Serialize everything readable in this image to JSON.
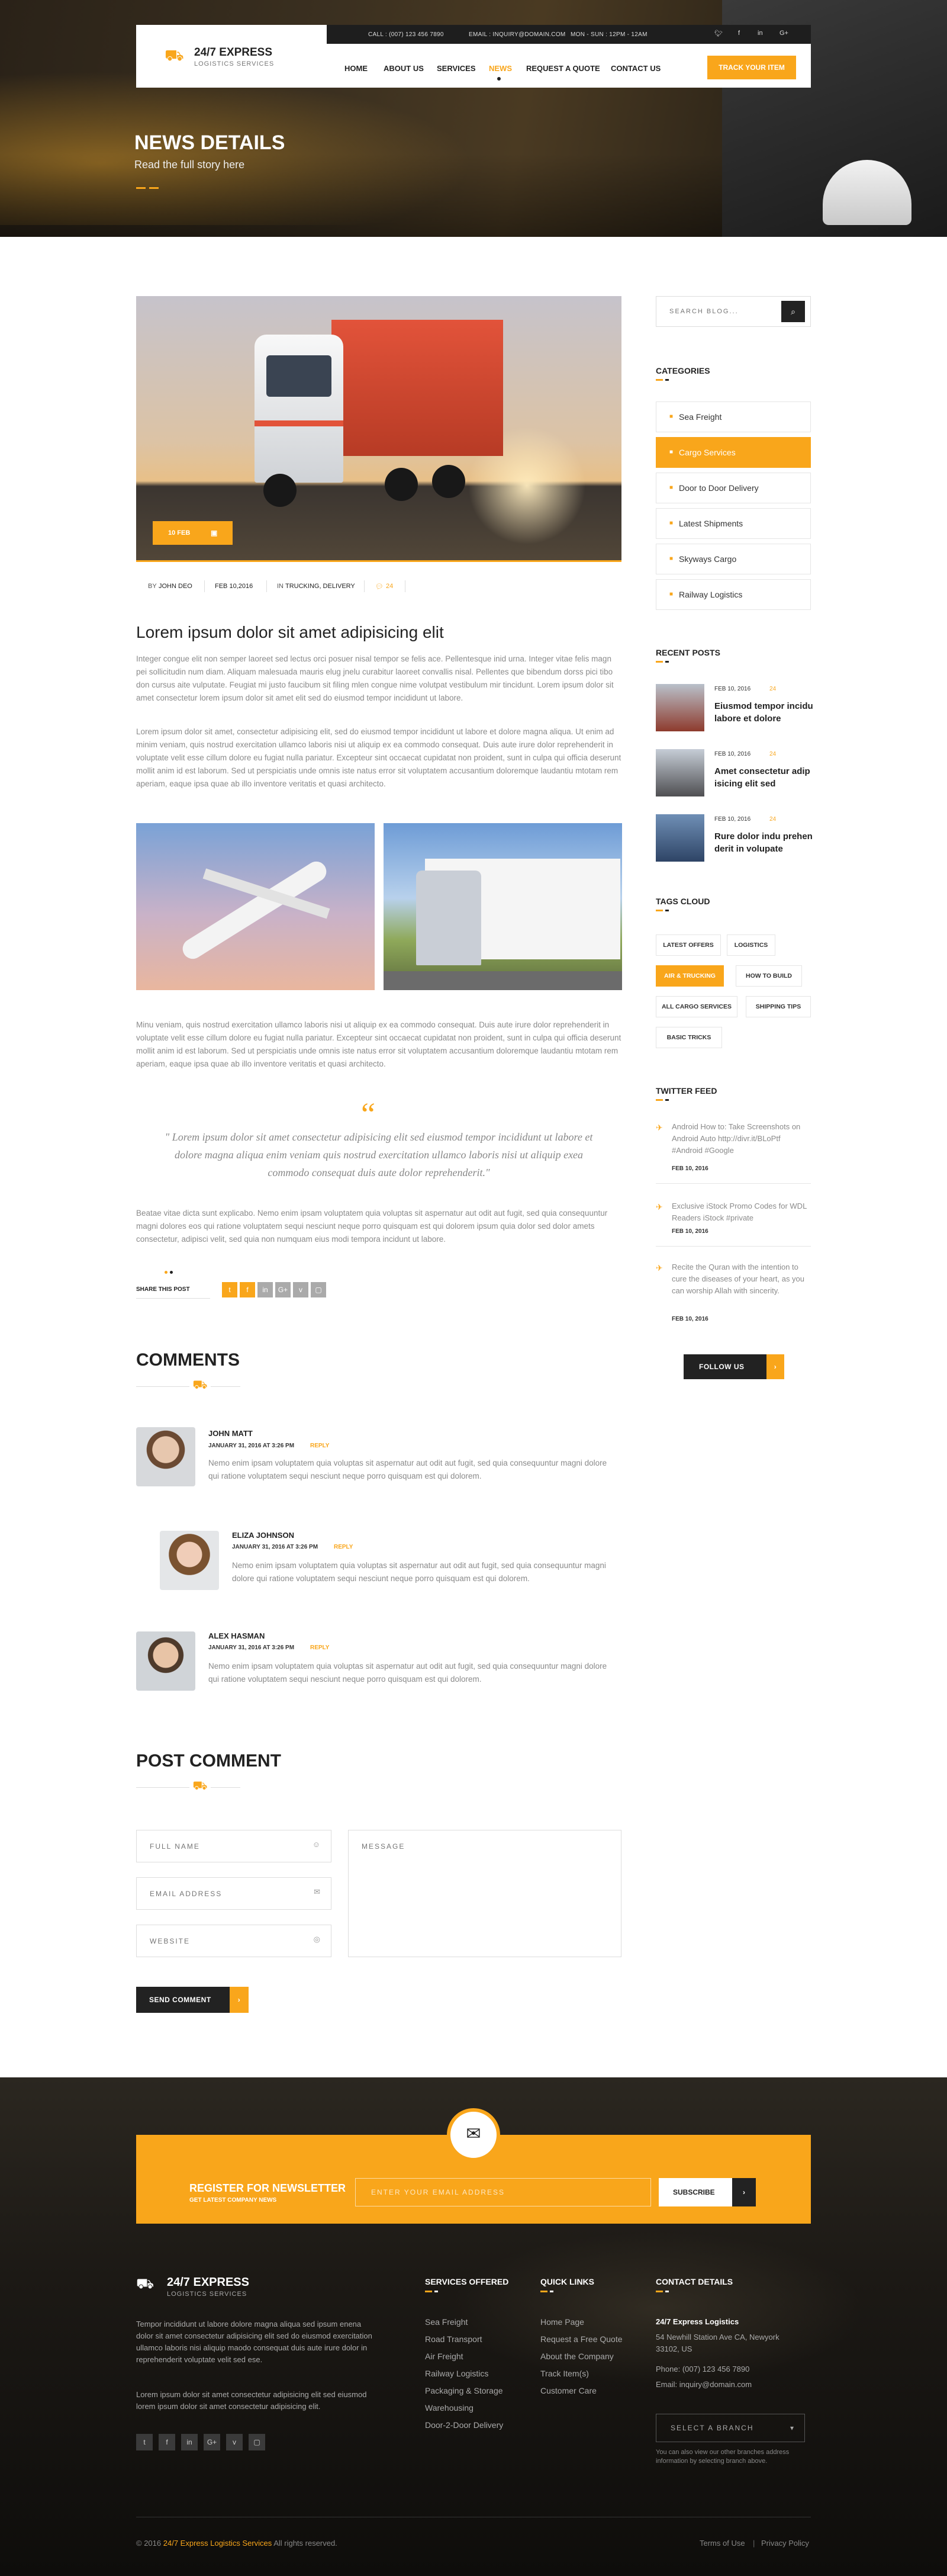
{
  "brand": {
    "name": "24/7 EXPRESS",
    "tagline": "LOGISTICS SERVICES"
  },
  "topbar": {
    "call": "CALL : (007) 123 456 7890",
    "email": "EMAIL : INQUIRY@DOMAIN.COM",
    "hours": "MON - SUN : 12PM - 12AM"
  },
  "nav": {
    "items": [
      "HOME",
      "ABOUT US",
      "SERVICES",
      "NEWS",
      "REQUEST A QUOTE",
      "CONTACT US"
    ],
    "active": "NEWS",
    "cta": "TRACK YOUR ITEM"
  },
  "hero": {
    "title": "NEWS DETAILS",
    "subtitle": "Read the full story here"
  },
  "post": {
    "date_badge": "10 FEB",
    "meta": {
      "author_prefix": "BY",
      "author": "JOHN DEO",
      "date": "FEB 10,2016",
      "cat_prefix": "IN",
      "categories": "TRUCKING, DELIVERY",
      "comments": "24"
    },
    "title": "Lorem ipsum dolor sit amet adipisicing elit",
    "para1": "Integer congue elit non semper laoreet sed lectus orci posuer nisal tempor se felis ace. Pellentesque inid urna. Integer vitae felis magn pei sollicitudin num diam. Aliquam malesuada mauris elug jnelu curabitur laoreet convallis nisal. Pellentes que bibendum dorss pici tibo don cursus aite vulputate. Feugiat mi justo faucibum sit filing mlen congue nime volutpat vestibulum mir tincidunt. Lorem ipsum dolor sit amet consectetur lorem ipsum dolor sit amet elit sed do eiusmod tempor incididunt ut labore.",
    "para2": "Lorem ipsum dolor sit amet, consectetur adipisicing elit, sed do eiusmod tempor incididunt ut labore et dolore magna aliqua. Ut enim ad minim veniam, quis nostrud exercitation ullamco laboris nisi ut aliquip ex ea commodo consequat. Duis aute irure dolor reprehenderit in voluptate velit esse cillum dolore eu fugiat nulla pariatur. Excepteur sint occaecat cupidatat non proident, sunt in culpa qui officia deserunt mollit anim id est laborum. Sed ut perspiciatis unde omnis iste natus error sit voluptatem accusantium doloremque laudantiu mtotam rem aperiam, eaque ipsa quae ab illo inventore veritatis et quasi architecto.",
    "para3": "Minu veniam, quis nostrud exercitation ullamco laboris nisi ut aliquip ex ea commodo consequat. Duis aute irure dolor reprehenderit in voluptate velit esse cillum dolore eu fugiat nulla pariatur. Excepteur sint occaecat cupidatat non proident, sunt in culpa qui officia deserunt mollit anim id est laborum. Sed ut perspiciatis unde omnis iste natus error sit voluptatem accusantium doloremque laudantiu mtotam rem aperiam, eaque ipsa quae ab illo inventore veritatis et quasi architecto.",
    "quote": "\" Lorem ipsum dolor sit amet consectetur adipisicing elit sed eiusmod tempor incididunt ut labore et dolore magna aliqua enim veniam quis nostrud exercitation ullamco laboris nisi ut aliquip exea commodo consequat duis aute dolor reprehenderit.\"",
    "para4": "Beatae vitae dicta sunt explicabo. Nemo enim ipsam voluptatem quia voluptas sit aspernatur aut odit aut fugit, sed quia consequuntur magni dolores eos qui ratione voluptatem sequi nesciunt neque porro quisquam est qui dolorem ipsum quia dolor sed dolor amets consectetur, adipisci velit, sed quia non numquam eius modi tempora incidunt ut labore.",
    "share_label": "SHARE THIS POST",
    "share_icons": [
      "twitter-icon",
      "facebook-icon",
      "linkedin-icon",
      "google-plus-icon",
      "vimeo-icon",
      "instagram-icon"
    ]
  },
  "comments": {
    "heading": "COMMENTS",
    "items": [
      {
        "name": "JOHN MATT",
        "date": "JANUARY 31, 2016 AT 3:26 PM",
        "reply": "REPLY",
        "text": "Nemo enim ipsam voluptatem quia voluptas sit aspernatur aut odit aut fugit, sed quia consequuntur magni dolore qui ratione voluptatem sequi nesciunt neque porro quisquam est qui dolorem."
      },
      {
        "name": "ELIZA JOHNSON",
        "date": "JANUARY 31, 2016 AT 3:26 PM",
        "reply": "REPLY",
        "text": "Nemo enim ipsam voluptatem quia voluptas sit aspernatur aut odit aut fugit, sed quia consequuntur magni dolore qui ratione voluptatem sequi nesciunt neque porro quisquam est qui dolorem."
      },
      {
        "name": "ALEX HASMAN",
        "date": "JANUARY 31, 2016 AT 3:26 PM",
        "reply": "REPLY",
        "text": "Nemo enim ipsam voluptatem quia voluptas sit aspernatur aut odit aut fugit, sed quia consequuntur magni dolore qui ratione voluptatem sequi nesciunt neque porro quisquam est qui dolorem."
      }
    ]
  },
  "post_comment": {
    "heading": "POST COMMENT",
    "full_name": "FULL NAME",
    "email": "EMAIL ADDRESS",
    "website": "WEBSITE",
    "message": "MESSAGE",
    "submit": "SEND COMMENT"
  },
  "sidebar": {
    "search_placeholder": "SEARCH BLOG...",
    "categories_heading": "CATEGORIES",
    "categories": [
      "Sea Freight",
      "Cargo Services",
      "Door to Door Delivery",
      "Latest Shipments",
      "Skyways Cargo",
      "Railway Logistics"
    ],
    "active_category": "Cargo Services",
    "recent_heading": "RECENT POSTS",
    "recent": [
      {
        "date": "FEB 10, 2016",
        "comments": "24",
        "title": "Eiusmod tempor incidu labore et dolore"
      },
      {
        "date": "FEB 10, 2016",
        "comments": "24",
        "title": "Amet consectetur adip isicing elit sed"
      },
      {
        "date": "FEB 10, 2016",
        "comments": "24",
        "title": "Rure dolor indu prehen derit in volupate"
      }
    ],
    "tags_heading": "TAGS CLOUD",
    "tags": [
      "LATEST OFFERS",
      "LOGISTICS",
      "AIR & TRUCKING",
      "HOW TO BUILD",
      "ALL CARGO SERVICES",
      "SHIPPING TIPS",
      "BASIC TRICKS"
    ],
    "active_tag": "AIR & TRUCKING",
    "twitter_heading": "TWITTER FEED",
    "tweets": [
      {
        "text": "Android How to: Take Screenshots on Android Auto http://divr.it/BLoPtf #Android #Google",
        "date": "FEB 10, 2016"
      },
      {
        "text": "Exclusive iStock Promo Codes for WDL Readers iStock #private",
        "date": "FEB 10, 2016"
      },
      {
        "text": "Recite the Quran with the intention to cure the diseases of your heart, as you can worship Allah with sincerity.",
        "date": "FEB 10, 2016"
      }
    ],
    "follow_label": "FOLLOW US"
  },
  "newsletter": {
    "title": "REGISTER FOR NEWSLETTER",
    "subtitle": "GET LATEST COMPANY NEWS",
    "placeholder": "ENTER YOUR EMAIL ADDRESS",
    "button": "SUBSCRIBE"
  },
  "footer": {
    "about1": "Tempor incididunt ut labore dolore magna aliqua sed ipsum enena dolor sit amet consectetur adipisicing elit sed do eiusmod exercitation ullamco laboris nisi aliquip maodo consequat duis aute irure dolor in reprehenderit voluptate velit sed ese.",
    "about2": "Lorem ipsum dolor sit amet consectetur adipisicing elit sed eiusmod lorem ipsum dolor sit amet consectetur adipisicing elit.",
    "social": [
      "twitter-icon",
      "facebook-icon",
      "linkedin-icon",
      "google-plus-icon",
      "vimeo-icon",
      "instagram-icon"
    ],
    "services_heading": "SERVICES OFFERED",
    "services": [
      "Sea Freight",
      "Road Transport",
      "Air Freight",
      "Railway Logistics",
      "Packaging & Storage",
      "Warehousing",
      "Door-2-Door Delivery"
    ],
    "quick_heading": "QUICK LINKS",
    "quick": [
      "Home Page",
      "Request a Free Quote",
      "About the Company",
      "Track Item(s)",
      "Customer Care"
    ],
    "contact_heading": "CONTACT DETAILS",
    "contact_name": "24/7 Express Logistics",
    "contact_address": "54 Newhill Station Ave CA, Newyork 33102, US",
    "contact_phone": "Phone: (007) 123 456 7890",
    "contact_email": "Email: inquiry@domain.com",
    "branch_select": "SELECT A BRANCH",
    "branch_note": "You can also view our other branches address information by selecting branch above.",
    "copyright_prefix": "© 2016",
    "copyright_brand": "24/7 Express Logistics Services",
    "copyright_suffix": "All rights reserved.",
    "terms": "Terms of Use",
    "privacy": "Privacy Policy"
  },
  "colors": {
    "accent": "#f9a61b",
    "dark": "#222222"
  }
}
